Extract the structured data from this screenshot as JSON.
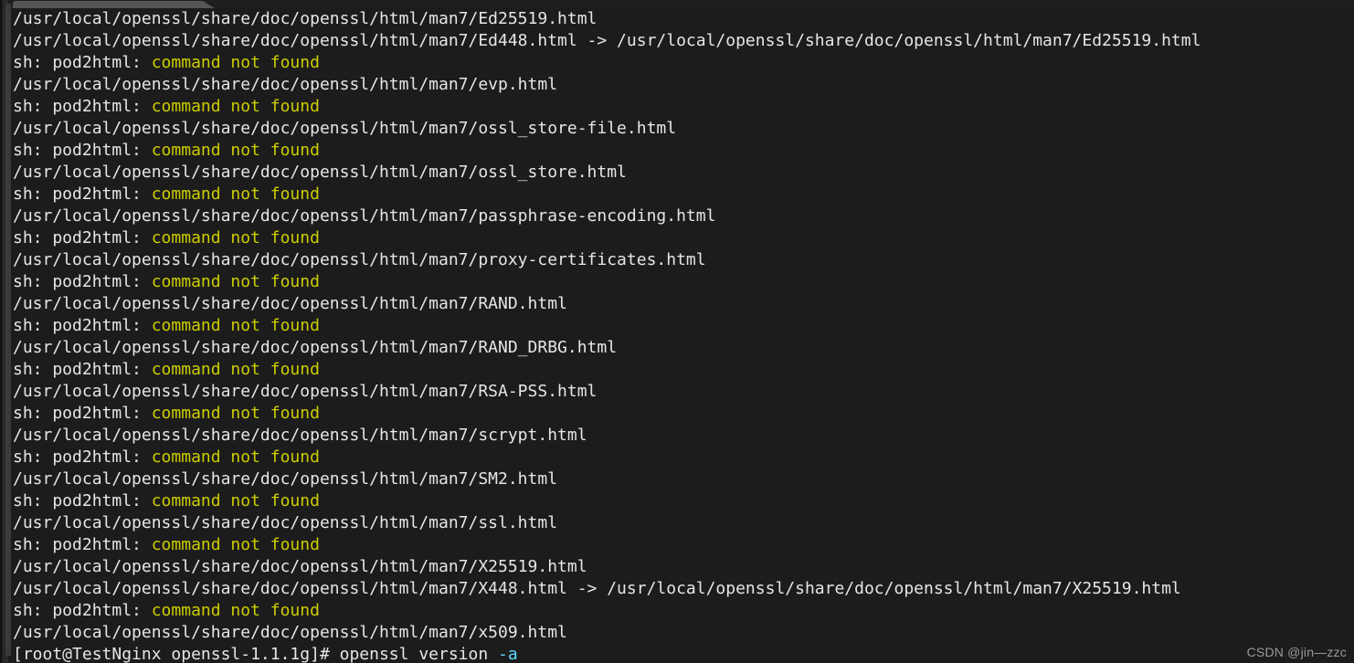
{
  "window": {
    "background_color": "#1c1c1c",
    "tab_bar_color": "#1e1e1e",
    "active_tab_color": "#555558",
    "tab_title": ""
  },
  "colors": {
    "foreground": "#e6e6e6",
    "error_yellow": "#cdcd00",
    "option_cyan": "#5fd7ff",
    "scrollbar_thumb": "#3a3a3c",
    "scrollbar_track": "#2a2a2a"
  },
  "terminal": {
    "prompt": "[root@TestNginx openssl-1.1.1g]#",
    "current_command": "openssl version -a",
    "error_message": "sh: pod2html: command not found",
    "lines": [
      {
        "segments": [
          {
            "text": "/usr/local/openssl/share/doc/openssl/html/man7/Ed25519.html",
            "color": "default"
          }
        ]
      },
      {
        "segments": [
          {
            "text": "/usr/local/openssl/share/doc/openssl/html/man7/Ed448.html -> /usr/local/openssl/share/doc/openssl/html/man7/Ed25519.html",
            "color": "default"
          }
        ]
      },
      {
        "segments": [
          {
            "text": "sh: pod2html: ",
            "color": "default"
          },
          {
            "text": "command not found",
            "color": "yellow"
          }
        ]
      },
      {
        "segments": [
          {
            "text": "/usr/local/openssl/share/doc/openssl/html/man7/evp.html",
            "color": "default"
          }
        ]
      },
      {
        "segments": [
          {
            "text": "sh: pod2html: ",
            "color": "default"
          },
          {
            "text": "command not found",
            "color": "yellow"
          }
        ]
      },
      {
        "segments": [
          {
            "text": "/usr/local/openssl/share/doc/openssl/html/man7/ossl_store-file.html",
            "color": "default"
          }
        ]
      },
      {
        "segments": [
          {
            "text": "sh: pod2html: ",
            "color": "default"
          },
          {
            "text": "command not found",
            "color": "yellow"
          }
        ]
      },
      {
        "segments": [
          {
            "text": "/usr/local/openssl/share/doc/openssl/html/man7/ossl_store.html",
            "color": "default"
          }
        ]
      },
      {
        "segments": [
          {
            "text": "sh: pod2html: ",
            "color": "default"
          },
          {
            "text": "command not found",
            "color": "yellow"
          }
        ]
      },
      {
        "segments": [
          {
            "text": "/usr/local/openssl/share/doc/openssl/html/man7/passphrase-encoding.html",
            "color": "default"
          }
        ]
      },
      {
        "segments": [
          {
            "text": "sh: pod2html: ",
            "color": "default"
          },
          {
            "text": "command not found",
            "color": "yellow"
          }
        ]
      },
      {
        "segments": [
          {
            "text": "/usr/local/openssl/share/doc/openssl/html/man7/proxy-certificates.html",
            "color": "default"
          }
        ]
      },
      {
        "segments": [
          {
            "text": "sh: pod2html: ",
            "color": "default"
          },
          {
            "text": "command not found",
            "color": "yellow"
          }
        ]
      },
      {
        "segments": [
          {
            "text": "/usr/local/openssl/share/doc/openssl/html/man7/RAND.html",
            "color": "default"
          }
        ]
      },
      {
        "segments": [
          {
            "text": "sh: pod2html: ",
            "color": "default"
          },
          {
            "text": "command not found",
            "color": "yellow"
          }
        ]
      },
      {
        "segments": [
          {
            "text": "/usr/local/openssl/share/doc/openssl/html/man7/RAND_DRBG.html",
            "color": "default"
          }
        ]
      },
      {
        "segments": [
          {
            "text": "sh: pod2html: ",
            "color": "default"
          },
          {
            "text": "command not found",
            "color": "yellow"
          }
        ]
      },
      {
        "segments": [
          {
            "text": "/usr/local/openssl/share/doc/openssl/html/man7/RSA-PSS.html",
            "color": "default"
          }
        ]
      },
      {
        "segments": [
          {
            "text": "sh: pod2html: ",
            "color": "default"
          },
          {
            "text": "command not found",
            "color": "yellow"
          }
        ]
      },
      {
        "segments": [
          {
            "text": "/usr/local/openssl/share/doc/openssl/html/man7/scrypt.html",
            "color": "default"
          }
        ]
      },
      {
        "segments": [
          {
            "text": "sh: pod2html: ",
            "color": "default"
          },
          {
            "text": "command not found",
            "color": "yellow"
          }
        ]
      },
      {
        "segments": [
          {
            "text": "/usr/local/openssl/share/doc/openssl/html/man7/SM2.html",
            "color": "default"
          }
        ]
      },
      {
        "segments": [
          {
            "text": "sh: pod2html: ",
            "color": "default"
          },
          {
            "text": "command not found",
            "color": "yellow"
          }
        ]
      },
      {
        "segments": [
          {
            "text": "/usr/local/openssl/share/doc/openssl/html/man7/ssl.html",
            "color": "default"
          }
        ]
      },
      {
        "segments": [
          {
            "text": "sh: pod2html: ",
            "color": "default"
          },
          {
            "text": "command not found",
            "color": "yellow"
          }
        ]
      },
      {
        "segments": [
          {
            "text": "/usr/local/openssl/share/doc/openssl/html/man7/X25519.html",
            "color": "default"
          }
        ]
      },
      {
        "segments": [
          {
            "text": "/usr/local/openssl/share/doc/openssl/html/man7/X448.html -> /usr/local/openssl/share/doc/openssl/html/man7/X25519.html",
            "color": "default"
          }
        ]
      },
      {
        "segments": [
          {
            "text": "sh: pod2html: ",
            "color": "default"
          },
          {
            "text": "command not found",
            "color": "yellow"
          }
        ]
      },
      {
        "segments": [
          {
            "text": "/usr/local/openssl/share/doc/openssl/html/man7/x509.html",
            "color": "default"
          }
        ]
      },
      {
        "segments": [
          {
            "text": "[root@TestNginx openssl-1.1.1g]# openssl version ",
            "color": "default"
          },
          {
            "text": "-a",
            "color": "cyan"
          }
        ]
      }
    ]
  },
  "watermark": {
    "text": "CSDN @jin—zzc"
  }
}
